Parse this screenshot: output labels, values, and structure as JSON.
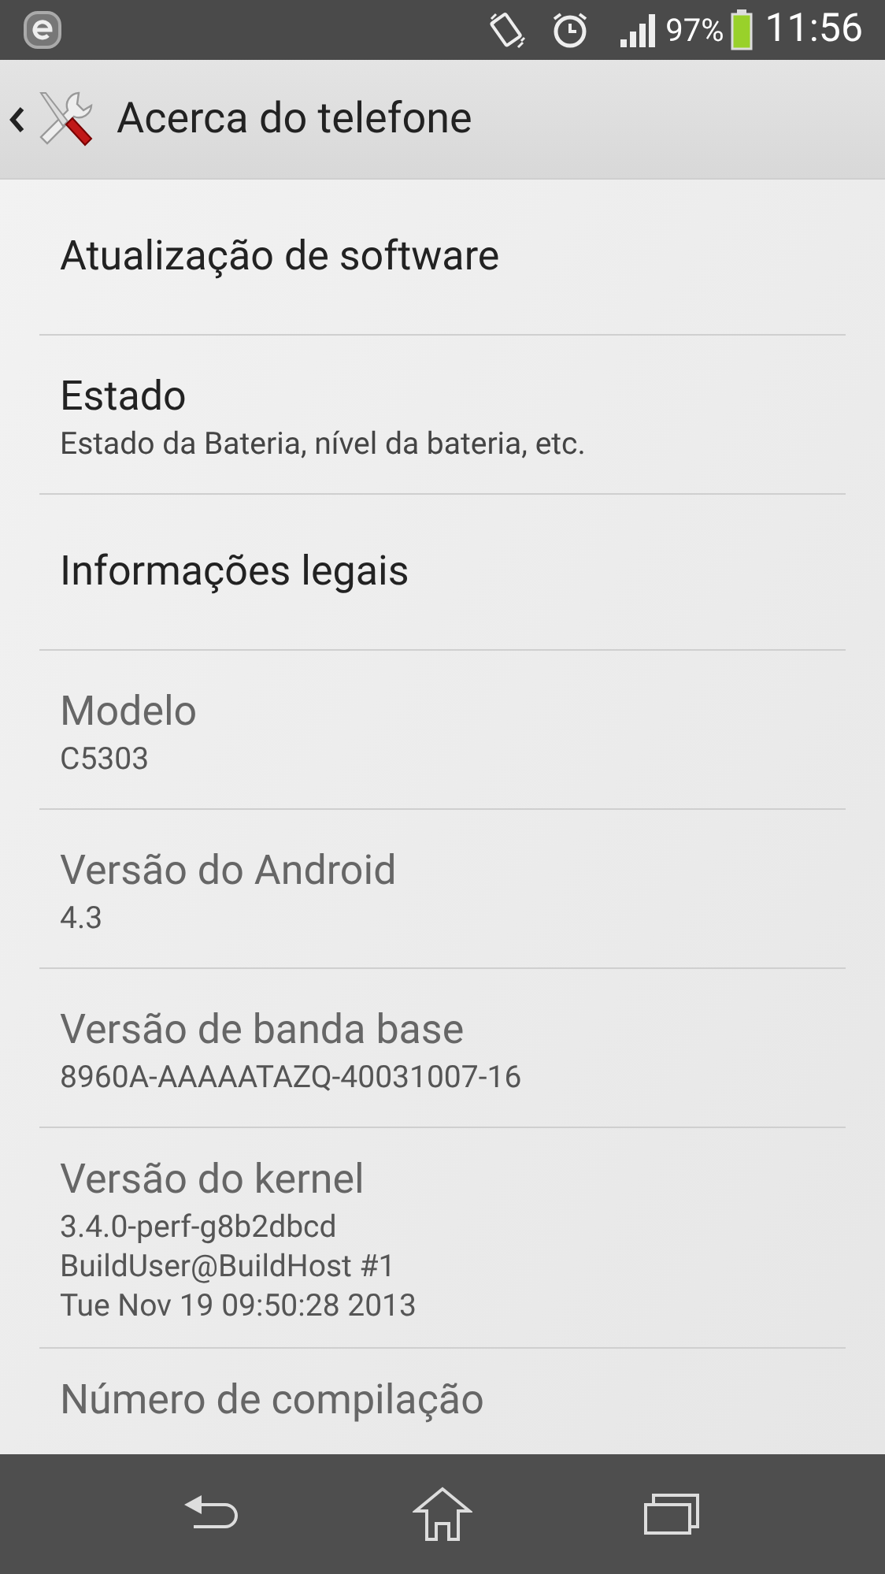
{
  "status_bar": {
    "battery_percent": "97%",
    "time": "11:56"
  },
  "header": {
    "title": "Acerca do telefone"
  },
  "items": [
    {
      "kind": "link",
      "title": "Atualização de software"
    },
    {
      "kind": "link",
      "title": "Estado",
      "subtitle": [
        "Estado da Bateria, nível da bateria, etc."
      ]
    },
    {
      "kind": "link",
      "title": "Informações legais"
    },
    {
      "kind": "info",
      "title": "Modelo",
      "subtitle": [
        "C5303"
      ]
    },
    {
      "kind": "info",
      "title": "Versão do Android",
      "subtitle": [
        "4.3"
      ]
    },
    {
      "kind": "info",
      "title": "Versão de banda base",
      "subtitle": [
        "8960A-AAAAATAZQ-40031007-16"
      ]
    },
    {
      "kind": "info",
      "title": "Versão do kernel",
      "subtitle": [
        "3.4.0-perf-g8b2dbcd",
        "BuildUser@BuildHost #1",
        "Tue Nov 19 09:50:28 2013"
      ]
    },
    {
      "kind": "info",
      "title": "Número de compilação"
    }
  ]
}
